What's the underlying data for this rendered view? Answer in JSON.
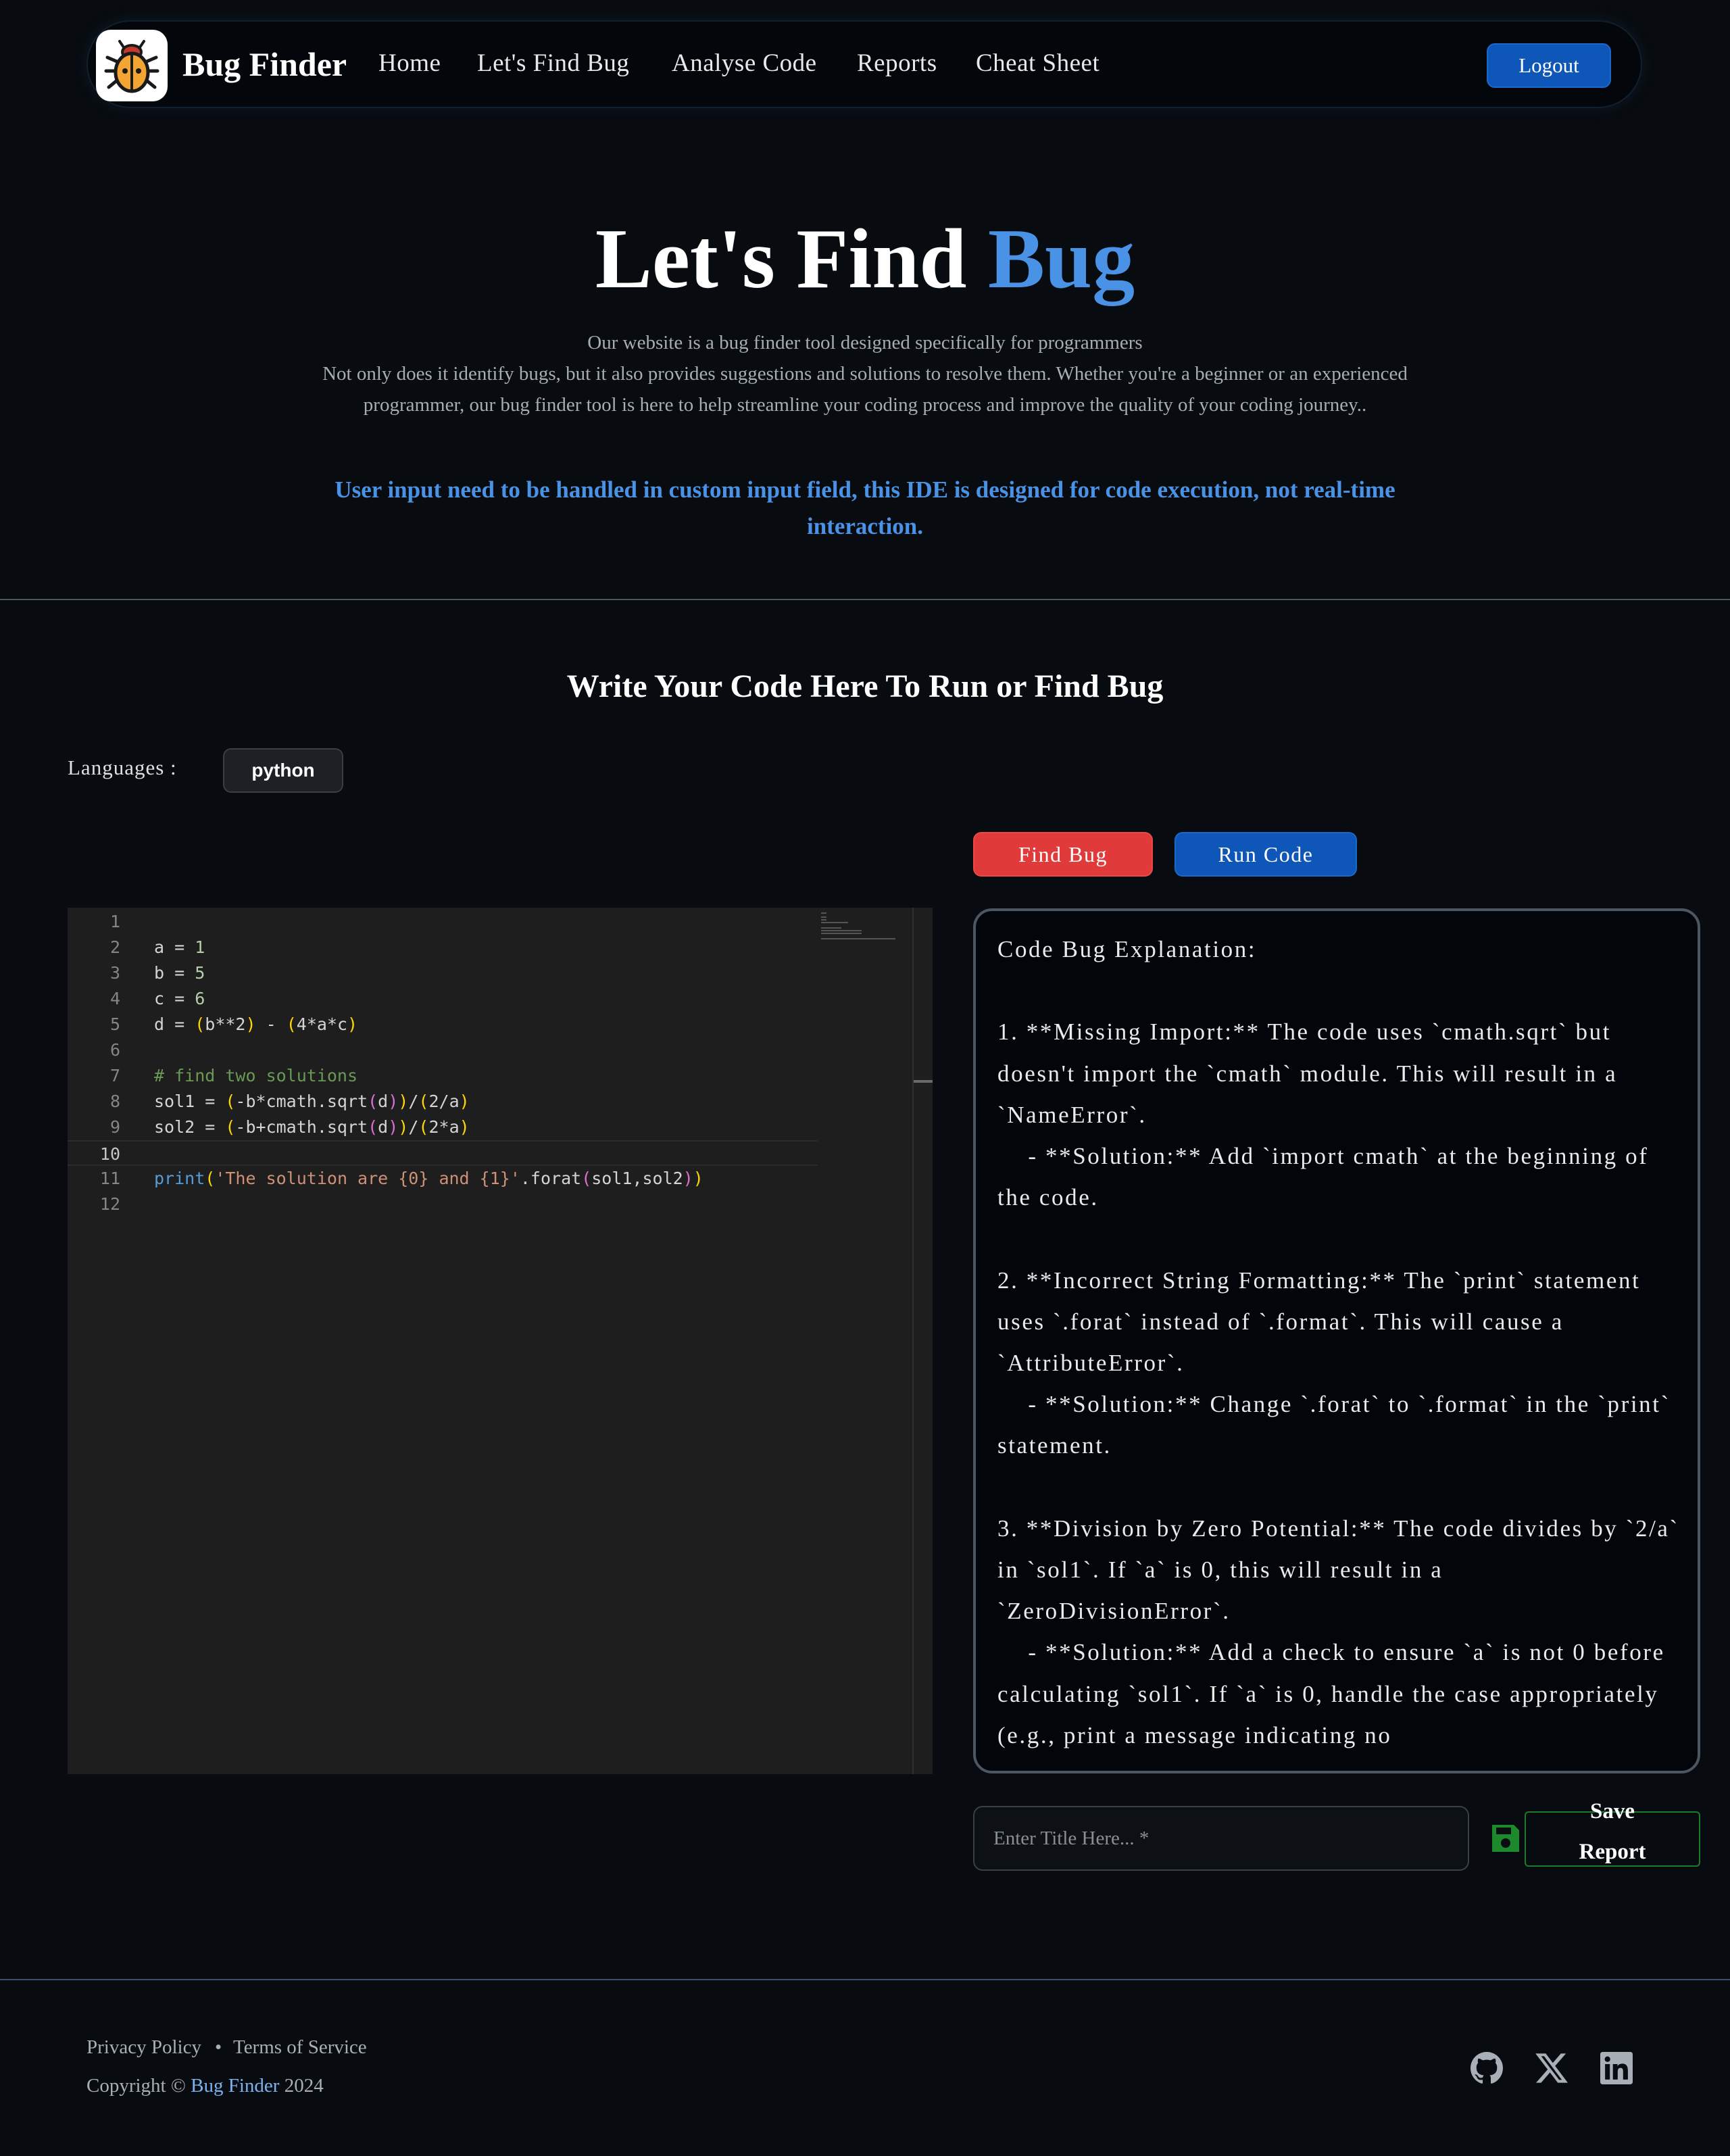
{
  "navbar": {
    "brand": "Bug Finder",
    "links": [
      "Home",
      "Let's Find Bug",
      "Analyse Code",
      "Reports",
      "Cheat Sheet"
    ],
    "logout_label": "Logout",
    "colors": {
      "primary": "#0e57b8",
      "accent": "#4a92e6",
      "logo_bug": "#f3a532"
    }
  },
  "hero": {
    "title_main": "Let's Find ",
    "title_accent": "Bug",
    "description_line1": "Our website is a bug finder tool designed specifically for programmers",
    "description_line2": "Not only does it identify bugs, but it also provides suggestions and solutions to resolve them. Whether you're a beginner or an experienced programmer, our bug finder tool is here to help streamline your coding process and improve the quality of your coding journey..",
    "note": "User input need to be handled in custom input field, this IDE is designed for code execution, not real-time interaction."
  },
  "editor_section": {
    "title": "Write Your Code Here To Run or Find Bug",
    "language_label": "Languages :",
    "language_value": "python",
    "find_bug_label": "Find Bug",
    "run_code_label": "Run Code",
    "colors": {
      "find_bug": "#e03a3a",
      "run_code": "#0e57b8"
    },
    "active_line": 10,
    "code_lines": [
      "",
      "a = 1",
      "b = 5",
      "c = 6",
      "d = (b**2) - (4*a*c)",
      "",
      "# find two solutions",
      "sol1 = (-b*cmath.sqrt(d))/(2/a)",
      "sol2 = (-b+cmath.sqrt(d))/(2*a)",
      "",
      "print('The solution are {0} and {1}'.forat(sol1,sol2))",
      ""
    ]
  },
  "explanation": {
    "text": "Code Bug Explanation:\n\n1. **Missing Import:** The code uses `cmath.sqrt` but doesn't import the `cmath` module. This will result in a `NameError`.\n    - **Solution:** Add `import cmath` at the beginning of the code.\n\n2. **Incorrect String Formatting:** The `print` statement uses `.forat` instead of `.format`. This will cause a `AttributeError`.\n    - **Solution:** Change `.forat` to `.format` in the `print` statement.\n\n3. **Division by Zero Potential:** The code divides by `2/a` in `sol1`. If `a` is 0, this will result in a `ZeroDivisionError`.\n    - **Solution:** Add a check to ensure `a` is not 0 before calculating `sol1`. If `a` is 0, handle the case appropriately (e.g., print a message indicating no"
  },
  "save_report": {
    "title_placeholder": "Enter Title Here... *",
    "title_value": "",
    "save_label_line1": "Save",
    "save_label_line2": "Report",
    "icon": "floppy-disk-icon",
    "color": "#1c8a2c"
  },
  "footer": {
    "privacy": "Privacy Policy",
    "separator": "•",
    "terms": "Terms of Service",
    "copyright_prefix": "Copyright © ",
    "copyright_brand": "Bug Finder",
    "copyright_year": " 2024",
    "social_icons": [
      "github-icon",
      "x-icon",
      "linkedin-icon"
    ]
  }
}
